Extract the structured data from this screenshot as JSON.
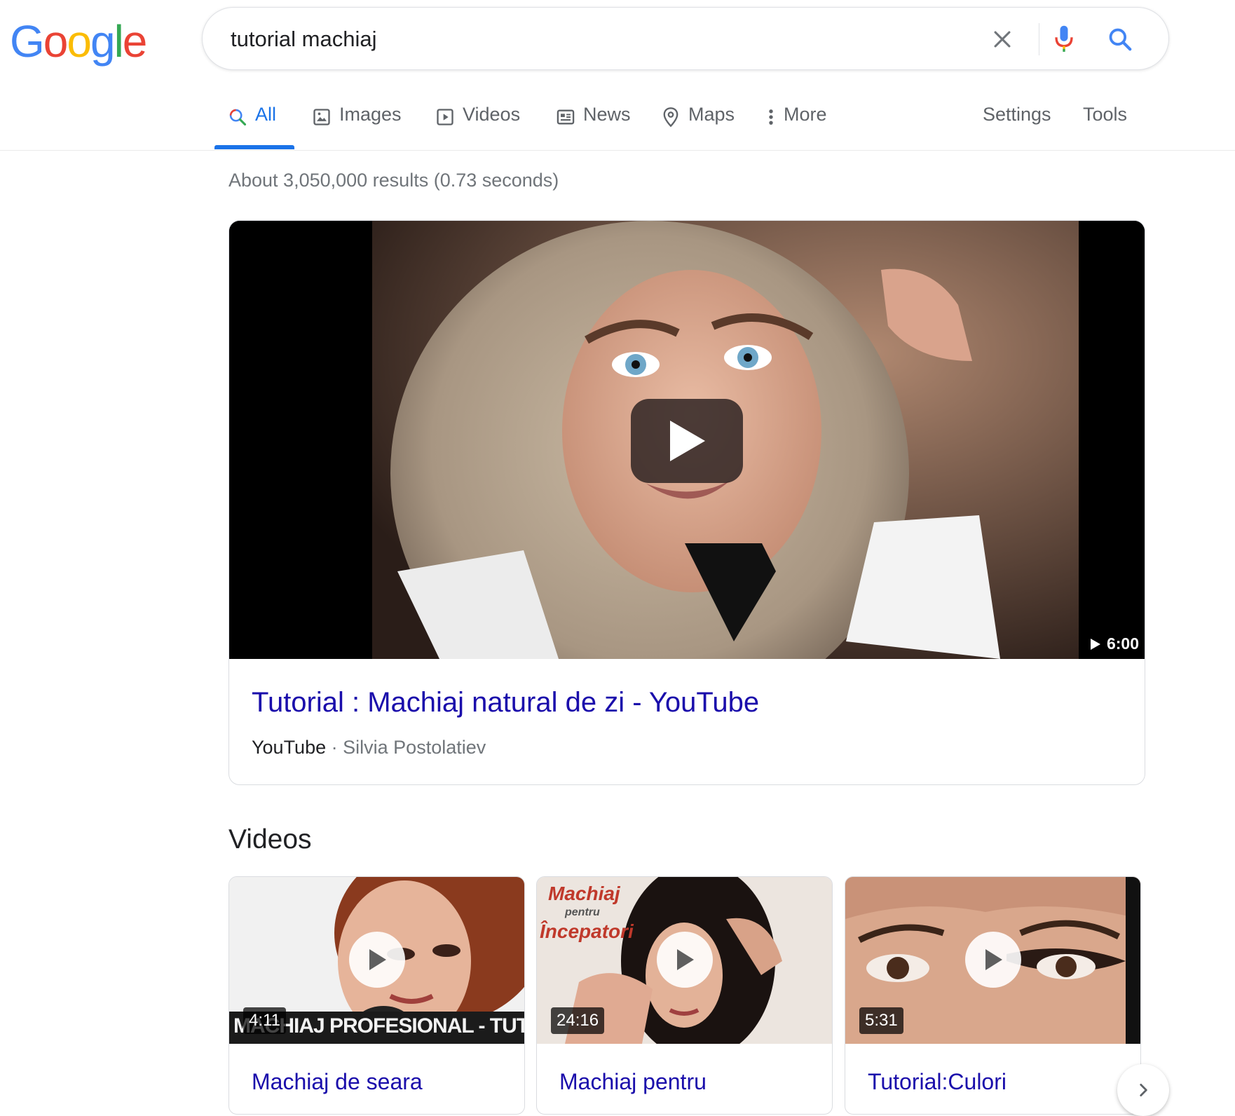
{
  "search": {
    "query": "tutorial machiaj"
  },
  "logo": {
    "letters": [
      "G",
      "o",
      "o",
      "g",
      "l",
      "e"
    ],
    "colors": [
      "#4285F4",
      "#EA4335",
      "#FBBC05",
      "#4285F4",
      "#34A853",
      "#EA4335"
    ]
  },
  "tabs": [
    {
      "label": "All",
      "icon": "search-icon",
      "active": true
    },
    {
      "label": "Images",
      "icon": "image-icon"
    },
    {
      "label": "Videos",
      "icon": "play-box-icon"
    },
    {
      "label": "News",
      "icon": "newspaper-icon"
    },
    {
      "label": "Maps",
      "icon": "map-pin-icon"
    },
    {
      "label": "More",
      "icon": "more-vert-icon"
    }
  ],
  "tools": {
    "settings": "Settings",
    "tools": "Tools"
  },
  "result_stats": "About 3,050,000 results (0.73 seconds)",
  "featured": {
    "title": "Tutorial : Machiaj natural de zi - YouTube",
    "source": "YouTube",
    "separator": "·",
    "author": "Silvia Postolatiev",
    "duration": "6:00"
  },
  "videos": {
    "heading": "Videos",
    "items": [
      {
        "title": "Machiaj de seara",
        "duration": "4:11",
        "overlay": "MACHIAJ PROFESIONAL - TUTORIAL"
      },
      {
        "title": "Machiaj pentru",
        "duration": "24:16",
        "overlay_top": "Machiaj",
        "overlay_mid": "pentru",
        "overlay_bottom": "Începatori"
      },
      {
        "title": "Tutorial:Culori",
        "duration": "5:31"
      }
    ]
  },
  "colors": {
    "link": "#1a0dab",
    "accent": "#1a73e8",
    "muted": "#70757a"
  }
}
